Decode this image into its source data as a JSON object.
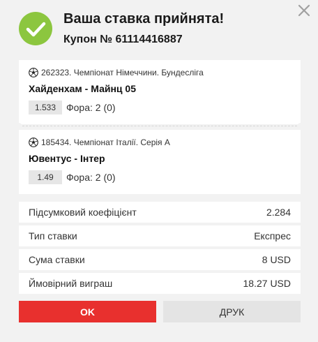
{
  "dialog": {
    "title": "Ваша ставка прийнята!",
    "coupon": "Купон № 61114416887"
  },
  "bets": [
    {
      "event": "262323. Чемпіонат Німеччини. Бундесліга",
      "match": "Хайденхам - Майнц 05",
      "odds": "1.533",
      "bet_type": "Фора: 2 (0)"
    },
    {
      "event": "185434. Чемпіонат Італії. Серія А",
      "match": "Ювентус - Інтер",
      "odds": "1.49",
      "bet_type": "Фора: 2 (0)"
    }
  ],
  "summary": [
    {
      "label": "Підсумковий коефіцієнт",
      "value": "2.284"
    },
    {
      "label": "Тип ставки",
      "value": "Експрес"
    },
    {
      "label": "Сума ставки",
      "value": "8 USD"
    },
    {
      "label": "Ймовірний виграш",
      "value": "18.27 USD"
    }
  ],
  "buttons": {
    "ok": "OK",
    "print": "ДРУК"
  },
  "icons": {
    "close": "close-icon",
    "success": "checkmark-icon",
    "sport": "soccer-ball-icon"
  },
  "colors": {
    "success": "#8cc63f",
    "primary": "#e8302e"
  }
}
